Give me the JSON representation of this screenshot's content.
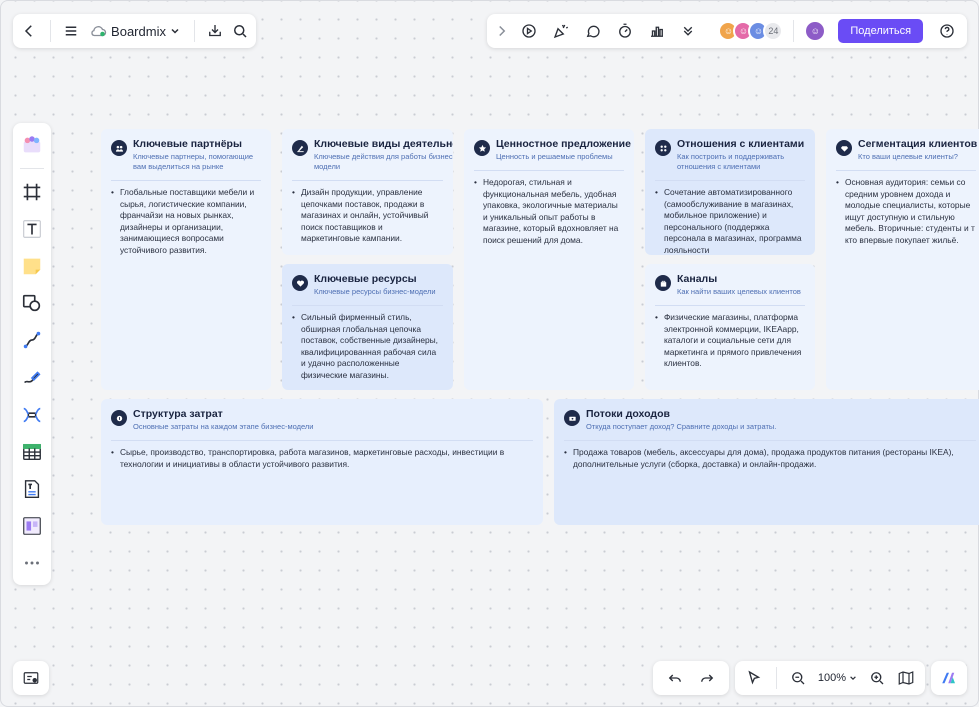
{
  "header": {
    "app_name": "Boardmix",
    "avatar_count": "24",
    "share_label": "Поделиться"
  },
  "bottom": {
    "zoom": "100%"
  },
  "canvas": {
    "partners": {
      "title": "Ключевые партнёры",
      "subtitle": "Ключевые партнеры, помогающие вам выделиться на рынке",
      "body": "Глобальные поставщики мебели и сырья, логистические компании, франчайзи на новых рынках, дизайнеры и организации, занимающиеся вопросами устойчивого развития."
    },
    "activities": {
      "title": "Ключевые виды деятельности",
      "subtitle": "Ключевые действия для работы бизнес-модели",
      "body": "Дизайн продукции, управление цепочками поставок, продажи в магазинах и онлайн, устойчивый поиск поставщиков и маркетинговые кампании."
    },
    "resources": {
      "title": "Ключевые ресурсы",
      "subtitle": "Ключевые ресурсы бизнес-модели",
      "body": "Сильный фирменный стиль, обширная глобальная цепочка поставок, собственные дизайнеры, квалифицированная рабочая сила и удачно расположенные физические магазины."
    },
    "value": {
      "title": "Ценностное предложение",
      "subtitle": "Ценность и решаемые проблемы",
      "body": "Недорогая, стильная и функциональная мебель, удобная упаковка, экологичные материалы и уникальный опыт работы в магазине, который вдохновляет на поиск решений для дома."
    },
    "relationships": {
      "title": "Отношения с клиентами",
      "subtitle": "Как построить и поддерживать отношения с клиентами",
      "body": "Сочетание автоматизированного (самообслуживание в магазинах, мобильное приложение) и персонального (поддержка персонала в магазинах, программа лояльности"
    },
    "channels": {
      "title": "Каналы",
      "subtitle": "Как найти ваших целевых клиентов",
      "body": "Физические магазины, платформа электронной коммерции, IKEAapp, каталоги и социальные сети для маркетинга и прямого привлечения клиентов."
    },
    "segments": {
      "title": "Сегментация клиентов",
      "subtitle": "Кто ваши целевые клиенты?",
      "body": "Основная аудитория: семьи со средним уровнем дохода и молодые специалисты, которые ищут доступную и стильную мебель. Вторичные: студенты и т кто впервые покупает жильё."
    },
    "costs": {
      "title": "Структура затрат",
      "subtitle": "Основные затраты на каждом этапе бизнес-модели",
      "body": "Сырье, производство, транспортировка, работа магазинов, маркетинговые расходы, инвестиции в технологии и инициативы в области устойчивого развития."
    },
    "revenue": {
      "title": "Потоки доходов",
      "subtitle": "Откуда поступает доход? Сравните доходы и затраты.",
      "body": "Продажа товаров (мебель, аксессуары для дома), продажа продуктов питания (рестораны IKEA), дополнительные услуги (сборка, доставка) и онлайн-продажи."
    }
  },
  "colors": {
    "accent": "#6a4cf5",
    "card_light": "#edf3fd",
    "card_dark": "#dde8fb",
    "title": "#1a2440",
    "subtitle": "#4e6fb3"
  }
}
